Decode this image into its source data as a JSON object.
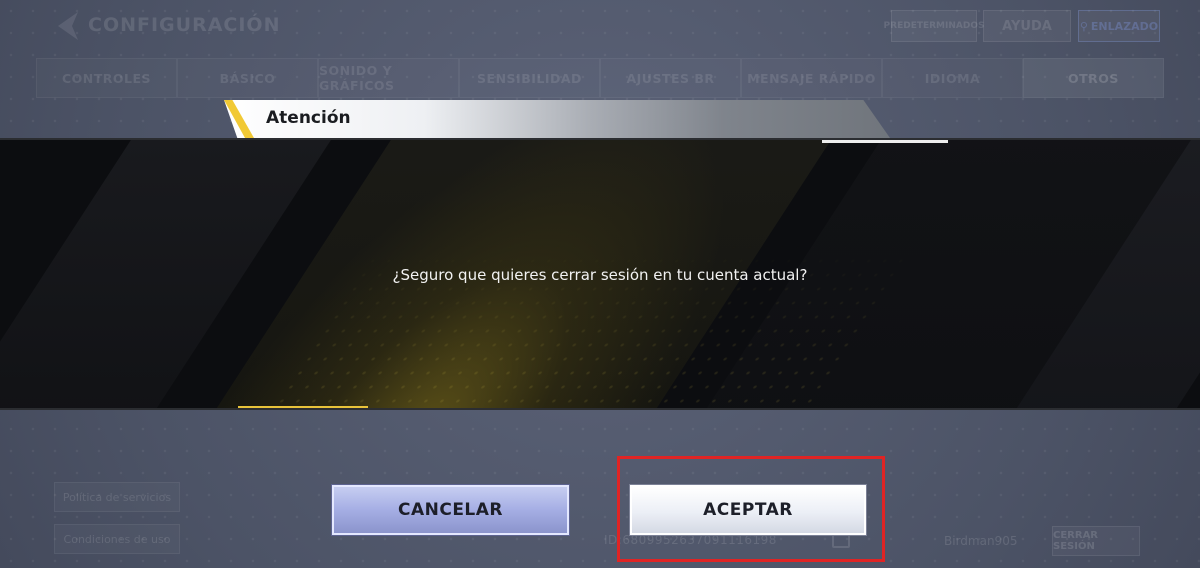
{
  "background": {
    "title": "CONFIGURACIÓN",
    "top_buttons": {
      "presets": "PREDETERMINADOS",
      "help": "AYUDA",
      "link": "ENLAZADO"
    },
    "tabs": [
      {
        "label": "CONTROLES"
      },
      {
        "label": "BÁSICO"
      },
      {
        "label": "SONIDO Y GRÁFICOS"
      },
      {
        "label": "SENSIBILIDAD"
      },
      {
        "label": "AJUSTES BR"
      },
      {
        "label": "MENSAJE RÁPIDO"
      },
      {
        "label": "IDIOMA"
      },
      {
        "label": "OTROS",
        "active": true
      }
    ],
    "bottom_left": {
      "service_policy": "Política de servicios",
      "terms": "Condiciones de uso"
    },
    "account_id": "ID:6809952637091116198",
    "username": "Birdman905",
    "logout_small": "CERRAR SESIÓN"
  },
  "modal": {
    "title": "Atención",
    "message": "¿Seguro que quieres cerrar sesión en tu cuenta actual?",
    "cancel_label": "CANCELAR",
    "accept_label": "ACEPTAR"
  },
  "colors": {
    "accent_gold": "#f1c935",
    "highlight_red": "#e02424",
    "cancel_button": "#a5aee4"
  },
  "icons": [
    "back-chevron-icon",
    "copy-icon",
    "link-icon"
  ]
}
